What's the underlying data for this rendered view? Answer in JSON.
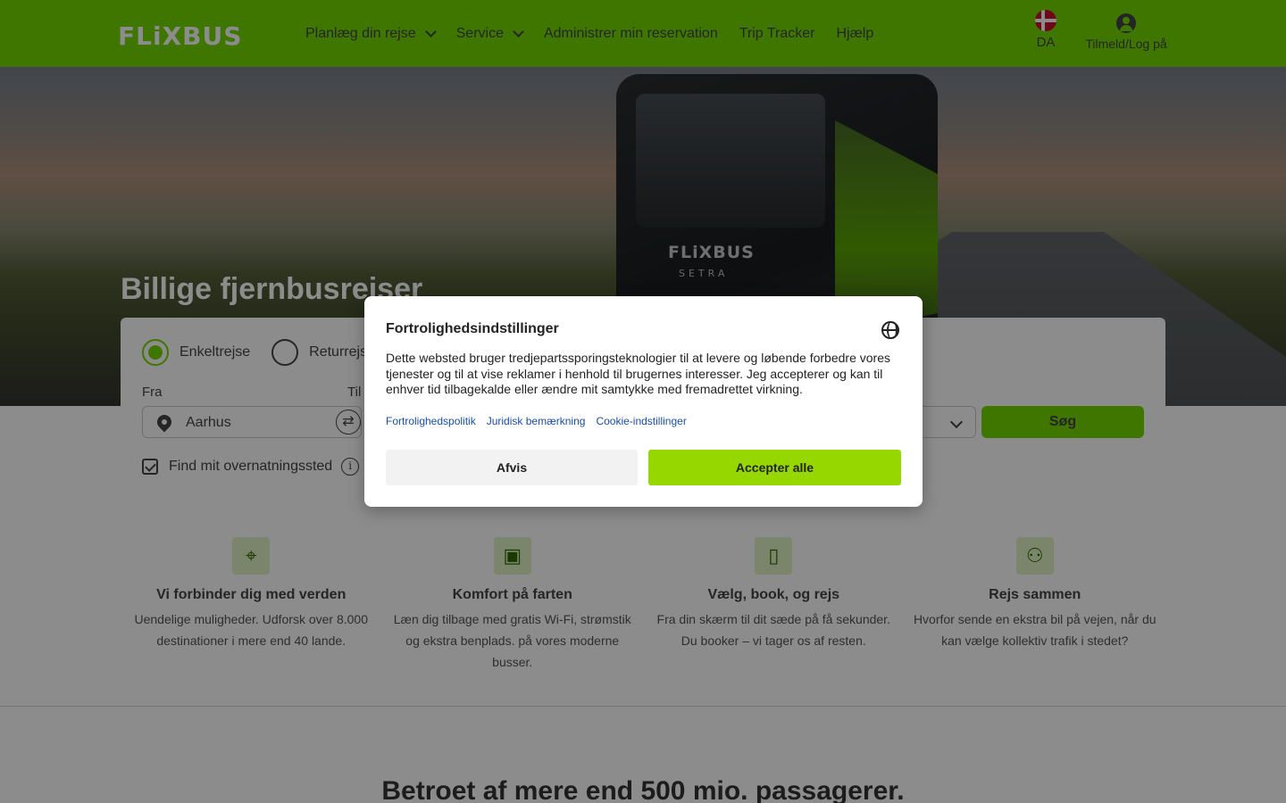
{
  "header": {
    "logo": "FLiXBUS",
    "nav": [
      {
        "label": "Planlæg din rejse",
        "has_dropdown": true
      },
      {
        "label": "Service",
        "has_dropdown": true
      },
      {
        "label": "Administrer min reservation",
        "has_dropdown": false
      },
      {
        "label": "Trip Tracker",
        "has_dropdown": false
      },
      {
        "label": "Hjælp",
        "has_dropdown": false
      }
    ],
    "language": "DA",
    "login_label": "Tilmeld/Log på"
  },
  "hero": {
    "title": "Billige fjernbusrejser",
    "bus_logo": "FLiXBUS",
    "bus_brand": "SETRA"
  },
  "search": {
    "trip_types": [
      {
        "label": "Enkeltrejse",
        "selected": true
      },
      {
        "label": "Returrejse",
        "selected": false
      }
    ],
    "from_label": "Fra",
    "from_value": "Aarhus",
    "to_label": "Til",
    "swap_icon": "⇄",
    "search_button": "Søg",
    "accommodation_label": "Find mit overnatningssted",
    "accommodation_checked": true,
    "info_icon": "i"
  },
  "features": [
    {
      "icon": "map-pin-icon",
      "glyph": "⌖",
      "title": "Vi forbinder dig med verden",
      "desc": "Uendelige muligheder. Udforsk over 8.000 destinationer i mere end 40 lande."
    },
    {
      "icon": "bus-icon",
      "glyph": "▣",
      "title": "Komfort på farten",
      "desc": "Læn dig tilbage med gratis Wi-Fi, strømstik og ekstra benplads. på vores moderne busser."
    },
    {
      "icon": "devices-icon",
      "glyph": "▯",
      "title": "Vælg, book, og rejs",
      "desc": "Fra din skærm til dit sæde på få sekunder. Du booker – vi tager os af resten."
    },
    {
      "icon": "group-icon",
      "glyph": "⚇",
      "title": "Rejs sammen",
      "desc": "Hvorfor sende en ekstra bil på vejen, når du kan vælge kollektiv trafik i stedet?"
    }
  ],
  "trust_heading": "Betroet af mere end 500 mio. passagerer.",
  "privacy_modal": {
    "title": "Fortrolighedsindstillinger",
    "text": "Dette websted bruger tredjepartssporingsteknologier til at levere og løbende forbedre vores tjenester og til at vise reklamer i henhold til brugernes interesser. Jeg accepterer og kan til enhver tid tilbagekalde eller ændre mit samtykke med fremadrettet virkning.",
    "links": [
      "Fortrolighedspolitik",
      "Juridisk bemærkning",
      "Cookie-indstillinger"
    ],
    "reject_label": "Afvis",
    "accept_label": "Accepter alle"
  },
  "colors": {
    "brand_green": "#73d700",
    "accept_green": "#97d700",
    "link_blue": "#1a4fa0"
  }
}
